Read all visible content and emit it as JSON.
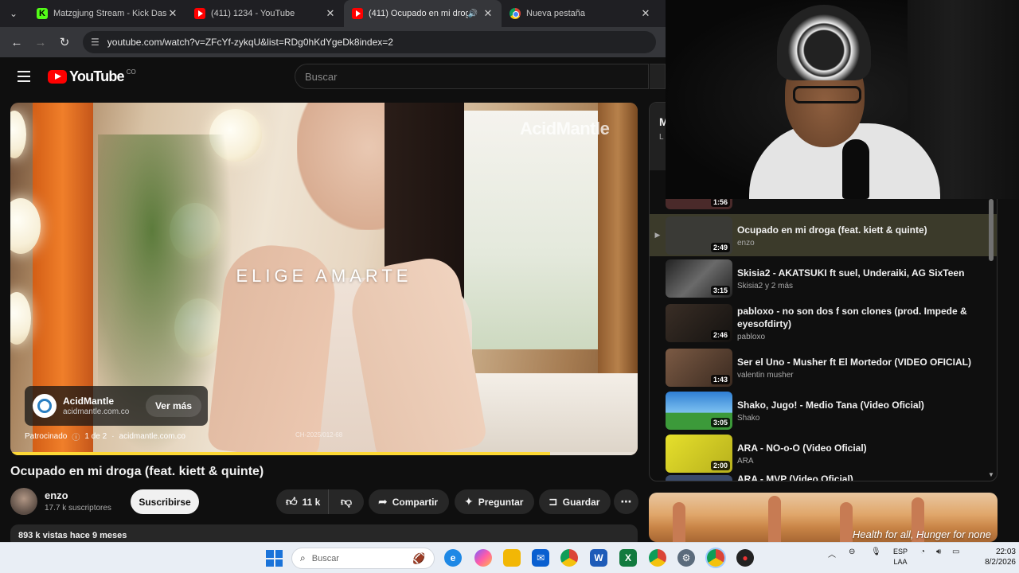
{
  "browser": {
    "tabs": [
      {
        "title": "Matzgjung Stream - Kick Dashb",
        "favicon": "kick-icon",
        "active": false
      },
      {
        "title": "(411) 1234 - YouTube",
        "favicon": "youtube-icon",
        "active": false
      },
      {
        "title": "(411) Ocupado en mi drog",
        "favicon": "youtube-icon",
        "active": true
      },
      {
        "title": "Nueva pestaña",
        "favicon": "chrome-icon",
        "active": false
      }
    ],
    "url": "youtube.com/watch?v=ZFcYf-zykqU&list=RDg0hKdYgeDk8index=2"
  },
  "youtube": {
    "logo_text": "YouTube",
    "logo_superscript": "CO",
    "search_placeholder": "Buscar"
  },
  "player": {
    "ad_overlay_text": "ELIGE AMARTE",
    "brand_watermark": "AcidMantle",
    "ad_card": {
      "name": "AcidMantle",
      "url": "acidmantle.com.co",
      "cta": "Ver más"
    },
    "ad_status": {
      "sponsored": "Patrocinado",
      "count": "1 de 2",
      "domain": "acidmantle.com.co"
    },
    "ad_fine_print": "CH-2025/012-68",
    "progress_fraction": 0.86
  },
  "video": {
    "title": "Ocupado en mi droga (feat. kiett & quinte)",
    "channel": "enzo",
    "subscribers": "17.7 k suscriptores",
    "subscribe_label": "Suscribirse",
    "likes": "11 k",
    "share_label": "Compartir",
    "ask_label": "Preguntar",
    "save_label": "Guardar",
    "description_meta": "893 k vistas  hace 9 meses"
  },
  "playlist": {
    "header_title": "M",
    "header_sub": "L",
    "partial_duration": "1:56",
    "items": [
      {
        "title": "Ocupado en mi droga (feat. kiett & quinte)",
        "channel": "enzo",
        "duration": "2:49",
        "active": true,
        "color": "#3a3a36"
      },
      {
        "title": "Skisia2 - AKATSUKI ft suel, Underaiki, AG SixTeen",
        "channel": "Skisia2 y 2 más",
        "duration": "3:15",
        "active": false,
        "color": "#5a5a5a"
      },
      {
        "title": "pabloxo - no son dos f son clones (prod. Impede & eyesofdirty)",
        "channel": "pabloxo",
        "duration": "2:46",
        "active": false,
        "color": "#2a2622"
      },
      {
        "title": "Ser el Uno - Musher ft El Mortedor (VIDEO OFICIAL)",
        "channel": "valentin musher",
        "duration": "1:43",
        "active": false,
        "color": "#6c4c3a"
      },
      {
        "title": "Shako, Jugo! - Medio Tana (Video Oficial)",
        "channel": "Shako",
        "duration": "3:05",
        "active": false,
        "color": "#2f7fd4"
      },
      {
        "title": "ARA - NO-o-O (Video Oficial)",
        "channel": "ARA",
        "duration": "2:00",
        "active": false,
        "color": "#d8d22a"
      },
      {
        "title": "ARA - MVP (Video Oficial)",
        "channel": "",
        "duration": "",
        "active": false,
        "color": "#3a4a6a"
      }
    ]
  },
  "ad_banner": {
    "text": "Health for all, Hunger for none"
  },
  "taskbar": {
    "search_placeholder": "Buscar",
    "lang_top": "ESP",
    "lang_bottom": "LAA",
    "time": "22:03",
    "date": "8/2/2026"
  }
}
